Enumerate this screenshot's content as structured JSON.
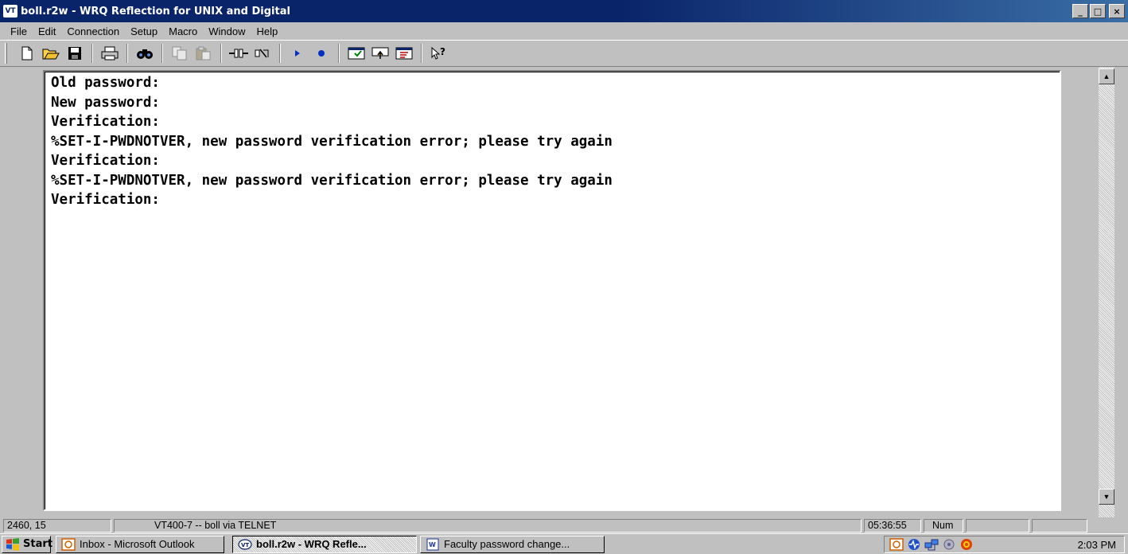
{
  "window": {
    "title": "boll.r2w - WRQ Reflection for UNIX and Digital",
    "app_icon_text": "VT",
    "minimize": "_",
    "maximize": "□",
    "close": "×"
  },
  "menu": [
    "File",
    "Edit",
    "Connection",
    "Setup",
    "Macro",
    "Window",
    "Help"
  ],
  "toolbar_icons": [
    "new-icon",
    "open-icon",
    "save-icon",
    "print-icon",
    "find-icon",
    "copy-icon",
    "paste-icon",
    "connect-icon",
    "disconnect-icon",
    "play-macro-icon",
    "record-macro-icon",
    "settings-icon",
    "transfer-icon",
    "keyboard-map-icon",
    "help-icon"
  ],
  "terminal": {
    "lines": [
      "Old password:",
      "New password:",
      "Verification:",
      "%SET-I-PWDNOTVER, new password verification error; please try again",
      "Verification:",
      "%SET-I-PWDNOTVER, new password verification error; please try again",
      "Verification:"
    ]
  },
  "statusbar": {
    "cursor_position": "2460, 15",
    "connection": "VT400-7 -- boll via TELNET",
    "time": "05:36:55",
    "num": "Num"
  },
  "taskbar": {
    "start": "Start",
    "tasks": [
      {
        "label": "Inbox - Microsoft Outlook",
        "icon": "outlook-icon",
        "active": false
      },
      {
        "label": "boll.r2w - WRQ Refle...",
        "icon": "reflection-icon",
        "active": true
      },
      {
        "label": "Faculty password change...",
        "icon": "word-icon",
        "active": false
      }
    ],
    "clock": "2:03 PM"
  },
  "colors": {
    "titlebar": "#0a246a",
    "face": "#c0c0c0",
    "terminal_bg": "#ffffff",
    "terminal_text": "#000000"
  }
}
